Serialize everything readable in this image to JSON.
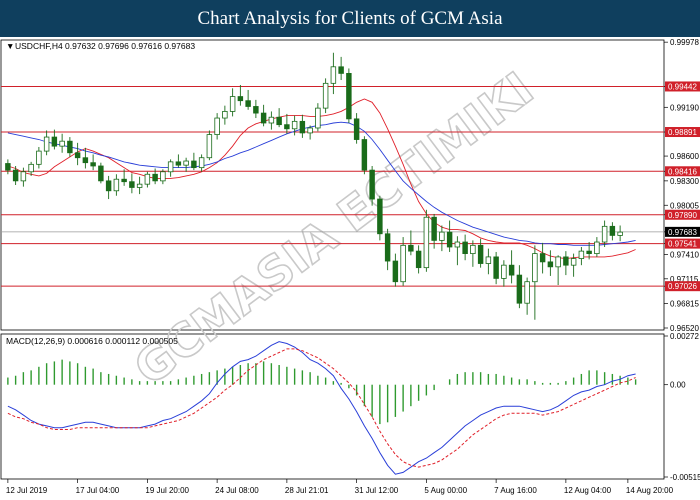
{
  "banner": {
    "title": "Chart Analysis for Clients of GCM Asia"
  },
  "watermark": {
    "text": "GCMASIA ECTIMIKI",
    "color": "#c9c9c9"
  },
  "colors": {
    "level_line": "#d0202a",
    "ma_red": "#e0202a",
    "ma_blue": "#2a3fd8",
    "candle": "#1a6b1a",
    "current_price_box": "#000000",
    "macd_hist": "#2f9a2f",
    "macd_main": "#2a3fd8",
    "macd_signal": "#e0202a"
  },
  "chart_data": [
    {
      "type": "line",
      "title": "",
      "symbol_header": "USDCHF,H4  0.97632 0.97696 0.97616 0.97683",
      "ylim": [
        0.9652,
        0.9998
      ],
      "y_ticks": [
        "0.99978",
        "0.99442",
        "0.99190",
        "0.98891",
        "0.98600",
        "0.98416",
        "0.98300",
        "0.98005",
        "0.97890",
        "0.97683",
        "0.97541",
        "0.97410",
        "0.97115",
        "0.97026",
        "0.96815",
        "0.96520"
      ],
      "x_ticks": [
        "12 Jul 2019",
        "17 Jul 04:00",
        "19 Jul 20:00",
        "24 Jul 08:00",
        "28 Jul 21:01",
        "31 Jul 12:00",
        "5 Aug 00:00",
        "7 Aug 16:00",
        "12 Aug 04:00",
        "14 Aug 20:00"
      ],
      "levels": [
        0.99442,
        0.98891,
        0.98416,
        0.9789,
        0.97541,
        0.97026
      ],
      "level_labels": [
        "0.99442",
        "0.98891",
        "0.98416",
        "0.97890",
        "0.97541",
        "0.97026"
      ],
      "current_price": 0.97683,
      "current_price_label": "0.97683",
      "series": [
        {
          "values": [
            0.9848,
            0.9845,
            0.984,
            0.9838,
            0.9836,
            0.9839,
            0.9847,
            0.9853,
            0.9859,
            0.9865,
            0.9869,
            0.9866,
            0.9862,
            0.9858,
            0.9852,
            0.9846,
            0.984,
            0.9838,
            0.9835,
            0.9833,
            0.9833,
            0.9833,
            0.9834,
            0.9836,
            0.9838,
            0.9841,
            0.9846,
            0.9852,
            0.9861,
            0.9872,
            0.9885,
            0.9894,
            0.9899,
            0.9902,
            0.9905,
            0.9907,
            0.9909,
            0.9909,
            0.9909,
            0.9908,
            0.9908,
            0.9909,
            0.9911,
            0.9914,
            0.9919,
            0.9925,
            0.9929,
            0.9925,
            0.9912,
            0.9893,
            0.9872,
            0.985,
            0.9826,
            0.9805,
            0.979,
            0.978,
            0.9774,
            0.9771,
            0.9771,
            0.977,
            0.9766,
            0.9761,
            0.9758,
            0.9756,
            0.9755,
            0.9755,
            0.9755,
            0.9752,
            0.9748,
            0.9743,
            0.9739,
            0.9737,
            0.9736,
            0.9737,
            0.9738,
            0.9738,
            0.9738,
            0.9738,
            0.9739,
            0.9741,
            0.9743,
            0.9747
          ]
        },
        {
          "values": [
            0.9888,
            0.9886,
            0.9884,
            0.9882,
            0.988,
            0.9877,
            0.9875,
            0.9873,
            0.9871,
            0.9869,
            0.9866,
            0.9864,
            0.9861,
            0.9859,
            0.9856,
            0.9853,
            0.9851,
            0.9849,
            0.9848,
            0.9847,
            0.9846,
            0.9846,
            0.9846,
            0.9846,
            0.9847,
            0.9848,
            0.985,
            0.9853,
            0.9857,
            0.986,
            0.9864,
            0.9867,
            0.9871,
            0.9875,
            0.9879,
            0.9883,
            0.9887,
            0.989,
            0.9893,
            0.9895,
            0.9897,
            0.9898,
            0.99,
            0.9901,
            0.99,
            0.9896,
            0.989,
            0.988,
            0.9868,
            0.9855,
            0.9842,
            0.983,
            0.9821,
            0.9813,
            0.9805,
            0.9798,
            0.9792,
            0.9787,
            0.9782,
            0.9778,
            0.9774,
            0.9771,
            0.9768,
            0.9765,
            0.9762,
            0.976,
            0.9758,
            0.9757,
            0.9755,
            0.9754,
            0.9754,
            0.9753,
            0.9753,
            0.9752,
            0.9752,
            0.9752,
            0.9752,
            0.9753,
            0.9754,
            0.9755,
            0.9756,
            0.9758
          ]
        }
      ]
    },
    {
      "type": "bar",
      "title": "MACD(12,26,9) 0.000616 0.000112 0.000505",
      "ylim": [
        -0.005155,
        0.00272
      ],
      "y_ticks": [
        "0.00272",
        "0.00",
        "-0.005155"
      ],
      "series": [
        {
          "values": [
            0.0004,
            0.0005,
            0.0007,
            0.0008,
            0.001,
            0.0012,
            0.0013,
            0.0014,
            0.0013,
            0.0012,
            0.001,
            0.0009,
            0.0007,
            0.0006,
            0.0005,
            0.0004,
            0.0003,
            0.0002,
            0.0002,
            0.0002,
            0.0002,
            0.0002,
            0.0003,
            0.0004,
            0.0005,
            0.0006,
            0.0007,
            0.0008,
            0.0009,
            0.001,
            0.0011,
            0.0012,
            0.0012,
            0.0013,
            0.0012,
            0.0011,
            0.001,
            0.0009,
            0.0008,
            0.0007,
            0.0005,
            0.0004,
            0.0002,
            0.0001,
            -0.0002,
            -0.0006,
            -0.0012,
            -0.0018,
            -0.0022,
            -0.0021,
            -0.0018,
            -0.0015,
            -0.0012,
            -0.0009,
            -0.0006,
            -0.0003,
            0.0,
            0.0003,
            0.0006,
            0.0007,
            0.0007,
            0.0007,
            0.0006,
            0.0006,
            0.0005,
            0.0004,
            0.0003,
            0.0003,
            0.0002,
            0.0001,
            0.0001,
            0.0001,
            0.0002,
            0.0004,
            0.0006,
            0.0008,
            0.0008,
            0.0007,
            0.0006,
            0.0005,
            0.0004,
            0.0003
          ]
        },
        {
          "values": [
            -0.0012,
            -0.0014,
            -0.0017,
            -0.002,
            -0.0022,
            -0.0023,
            -0.0024,
            -0.0024,
            -0.0023,
            -0.0022,
            -0.0021,
            -0.0021,
            -0.0022,
            -0.0023,
            -0.0024,
            -0.0024,
            -0.0024,
            -0.0024,
            -0.0023,
            -0.0022,
            -0.002,
            -0.0019,
            -0.0017,
            -0.0015,
            -0.0012,
            -0.0009,
            -0.0005,
            0.0001,
            0.0006,
            0.001,
            0.0013,
            0.0014,
            0.0016,
            0.0019,
            0.0022,
            0.0024,
            0.0023,
            0.0021,
            0.0018,
            0.0014,
            0.0012,
            0.0009,
            0.0005,
            -0.0002,
            -0.0008,
            -0.0015,
            -0.0023,
            -0.003,
            -0.0038,
            -0.0045,
            -0.005,
            -0.0049,
            -0.0046,
            -0.0043,
            -0.0041,
            -0.0038,
            -0.0035,
            -0.0031,
            -0.0027,
            -0.0023,
            -0.002,
            -0.0017,
            -0.0015,
            -0.0013,
            -0.0012,
            -0.0012,
            -0.0012,
            -0.0013,
            -0.0014,
            -0.0015,
            -0.0014,
            -0.0012,
            -0.0009,
            -0.0006,
            -0.0004,
            -0.0003,
            -0.0001,
            0.0,
            0.0002,
            0.0003,
            0.0005,
            0.0006
          ]
        },
        {
          "values": [
            -0.0016,
            -0.0018,
            -0.0019,
            -0.0021,
            -0.0022,
            -0.0024,
            -0.0025,
            -0.0025,
            -0.0025,
            -0.0024,
            -0.0024,
            -0.0024,
            -0.0024,
            -0.0024,
            -0.0024,
            -0.0024,
            -0.0024,
            -0.0024,
            -0.0024,
            -0.0023,
            -0.0022,
            -0.0021,
            -0.002,
            -0.0018,
            -0.0016,
            -0.0013,
            -0.001,
            -0.0007,
            -0.0003,
            0.0,
            0.0004,
            0.0008,
            0.0011,
            0.0014,
            0.0016,
            0.0018,
            0.002,
            0.002,
            0.0019,
            0.0017,
            0.0015,
            0.0012,
            0.0009,
            0.0005,
            0.0001,
            -0.0004,
            -0.0011,
            -0.0018,
            -0.0026,
            -0.0033,
            -0.0039,
            -0.0043,
            -0.0045,
            -0.0046,
            -0.0045,
            -0.0044,
            -0.0042,
            -0.0039,
            -0.0036,
            -0.0032,
            -0.0028,
            -0.0025,
            -0.0022,
            -0.0019,
            -0.0017,
            -0.0016,
            -0.0016,
            -0.0016,
            -0.0016,
            -0.0017,
            -0.0016,
            -0.0015,
            -0.0013,
            -0.0011,
            -0.0009,
            -0.0007,
            -0.0005,
            -0.0003,
            -0.0001,
            0.0001,
            0.0002,
            0.0004
          ]
        }
      ]
    }
  ],
  "candles": [
    [
      0.9851,
      0.9856,
      0.9838,
      0.9843
    ],
    [
      0.9843,
      0.9848,
      0.9825,
      0.983
    ],
    [
      0.983,
      0.9846,
      0.9823,
      0.9841
    ],
    [
      0.9841,
      0.9853,
      0.9836,
      0.985
    ],
    [
      0.985,
      0.9871,
      0.9845,
      0.9866
    ],
    [
      0.9866,
      0.9891,
      0.9861,
      0.9883
    ],
    [
      0.9883,
      0.9892,
      0.9868,
      0.9872
    ],
    [
      0.9872,
      0.9887,
      0.9864,
      0.9878
    ],
    [
      0.9878,
      0.9883,
      0.9859,
      0.9864
    ],
    [
      0.9864,
      0.9876,
      0.9849,
      0.9858
    ],
    [
      0.9858,
      0.987,
      0.9845,
      0.9852
    ],
    [
      0.9852,
      0.9862,
      0.9843,
      0.9848
    ],
    [
      0.9848,
      0.9852,
      0.9827,
      0.983
    ],
    [
      0.983,
      0.9836,
      0.9808,
      0.9818
    ],
    [
      0.9818,
      0.9838,
      0.9812,
      0.9832
    ],
    [
      0.9832,
      0.9844,
      0.9824,
      0.9829
    ],
    [
      0.9829,
      0.9839,
      0.9815,
      0.9822
    ],
    [
      0.9822,
      0.9835,
      0.9814,
      0.9826
    ],
    [
      0.9826,
      0.9841,
      0.9822,
      0.9838
    ],
    [
      0.9838,
      0.9845,
      0.9826,
      0.983
    ],
    [
      0.983,
      0.9844,
      0.9826,
      0.9841
    ],
    [
      0.9841,
      0.9856,
      0.9835,
      0.9853
    ],
    [
      0.9853,
      0.9862,
      0.9846,
      0.9849
    ],
    [
      0.9849,
      0.9858,
      0.9841,
      0.9854
    ],
    [
      0.9854,
      0.9864,
      0.9843,
      0.9846
    ],
    [
      0.9846,
      0.9862,
      0.9841,
      0.9858
    ],
    [
      0.9858,
      0.9891,
      0.9855,
      0.9886
    ],
    [
      0.9886,
      0.9912,
      0.988,
      0.9906
    ],
    [
      0.9906,
      0.9921,
      0.9898,
      0.9914
    ],
    [
      0.9914,
      0.9942,
      0.9908,
      0.9932
    ],
    [
      0.9932,
      0.9946,
      0.9921,
      0.9927
    ],
    [
      0.9927,
      0.994,
      0.9916,
      0.992
    ],
    [
      0.992,
      0.9928,
      0.9906,
      0.9912
    ],
    [
      0.9912,
      0.9922,
      0.9896,
      0.99
    ],
    [
      0.99,
      0.9914,
      0.9892,
      0.9907
    ],
    [
      0.9907,
      0.9918,
      0.9895,
      0.9898
    ],
    [
      0.9898,
      0.9911,
      0.9887,
      0.9893
    ],
    [
      0.9893,
      0.9909,
      0.9885,
      0.9902
    ],
    [
      0.9902,
      0.991,
      0.9882,
      0.9888
    ],
    [
      0.9888,
      0.9897,
      0.988,
      0.9894
    ],
    [
      0.9894,
      0.9924,
      0.989,
      0.9918
    ],
    [
      0.9918,
      0.9954,
      0.9912,
      0.9948
    ],
    [
      0.9948,
      0.9985,
      0.9935,
      0.9968
    ],
    [
      0.9968,
      0.998,
      0.9952,
      0.996
    ],
    [
      0.996,
      0.9966,
      0.99,
      0.9905
    ],
    [
      0.9905,
      0.9912,
      0.9875,
      0.988
    ],
    [
      0.988,
      0.9884,
      0.9838,
      0.9843
    ],
    [
      0.9843,
      0.9848,
      0.98,
      0.9808
    ],
    [
      0.9808,
      0.9812,
      0.9758,
      0.9766
    ],
    [
      0.9766,
      0.9772,
      0.9722,
      0.9733
    ],
    [
      0.9733,
      0.9742,
      0.9702,
      0.9708
    ],
    [
      0.9708,
      0.9762,
      0.9703,
      0.9752
    ],
    [
      0.9752,
      0.977,
      0.974,
      0.9745
    ],
    [
      0.9745,
      0.9752,
      0.9718,
      0.9725
    ],
    [
      0.9725,
      0.9795,
      0.972,
      0.9786
    ],
    [
      0.9786,
      0.979,
      0.9748,
      0.9758
    ],
    [
      0.9758,
      0.9776,
      0.9745,
      0.9768
    ],
    [
      0.9768,
      0.9782,
      0.9744,
      0.975
    ],
    [
      0.975,
      0.9763,
      0.9728,
      0.9756
    ],
    [
      0.9756,
      0.9765,
      0.9734,
      0.9742
    ],
    [
      0.9742,
      0.9758,
      0.9726,
      0.9752
    ],
    [
      0.9752,
      0.976,
      0.9725,
      0.973
    ],
    [
      0.973,
      0.9748,
      0.9717,
      0.9738
    ],
    [
      0.9738,
      0.9744,
      0.9705,
      0.9712
    ],
    [
      0.9712,
      0.9734,
      0.9702,
      0.9728
    ],
    [
      0.9728,
      0.9746,
      0.9706,
      0.9716
    ],
    [
      0.9716,
      0.9728,
      0.9676,
      0.9682
    ],
    [
      0.9682,
      0.9713,
      0.9668,
      0.9708
    ],
    [
      0.9708,
      0.9752,
      0.9662,
      0.9742
    ],
    [
      0.9742,
      0.9755,
      0.9718,
      0.9732
    ],
    [
      0.9732,
      0.9746,
      0.9715,
      0.9726
    ],
    [
      0.9726,
      0.974,
      0.9704,
      0.9738
    ],
    [
      0.9738,
      0.9745,
      0.9716,
      0.9728
    ],
    [
      0.9728,
      0.9742,
      0.9714,
      0.9736
    ],
    [
      0.9736,
      0.975,
      0.9728,
      0.9745
    ],
    [
      0.9745,
      0.9756,
      0.9735,
      0.9742
    ],
    [
      0.9742,
      0.9762,
      0.9738,
      0.9756
    ],
    [
      0.9756,
      0.9782,
      0.975,
      0.9775
    ],
    [
      0.9775,
      0.978,
      0.9758,
      0.9764
    ],
    [
      0.9764,
      0.9776,
      0.9757,
      0.9768
    ]
  ]
}
